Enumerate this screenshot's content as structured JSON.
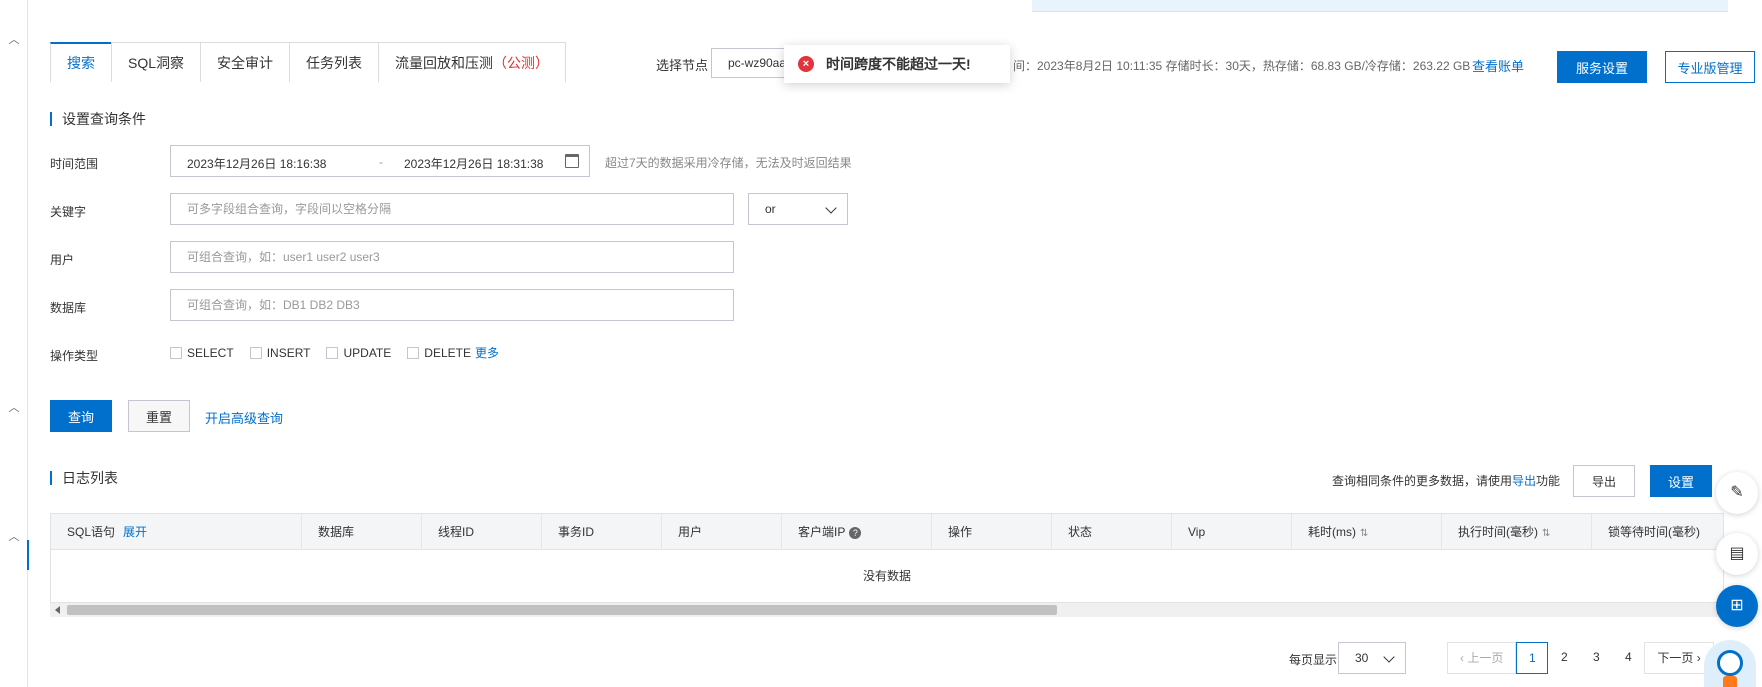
{
  "tabs": [
    {
      "label": "搜索",
      "suffix": ""
    },
    {
      "label": "SQL洞察",
      "suffix": ""
    },
    {
      "label": "安全审计",
      "suffix": ""
    },
    {
      "label": "任务列表",
      "suffix": ""
    },
    {
      "label": "流量回放和压测",
      "suffix": "（公测）"
    }
  ],
  "node": {
    "label": "选择节点",
    "value": "pc-wz90aa",
    "info": "间：2023年8月2日 10:11:35 存储时长：30天，热存储：68.83 GB/冷存储：263.22 GB",
    "bill_link": "查看账单",
    "service_settings": "服务设置",
    "pro_manage": "专业版管理"
  },
  "toast": {
    "message": "时间跨度不能超过一天!",
    "icon": "error-circle-icon"
  },
  "query_section": {
    "title": "设置查询条件",
    "time_label": "时间范围",
    "start_time": "2023年12月26日 18:16:38",
    "separator": "-",
    "end_time": "2023年12月26日 18:31:38",
    "time_hint": "超过7天的数据采用冷存储，无法及时返回结果",
    "keyword_label": "关键字",
    "keyword_value": "",
    "keyword_placeholder": "可多字段组合查询，字段间以空格分隔",
    "logic_value": "or",
    "user_label": "用户",
    "user_value": "",
    "user_placeholder": "可组合查询，如：user1 user2 user3",
    "db_label": "数据库",
    "db_value": "",
    "db_placeholder": "可组合查询，如：DB1 DB2 DB3",
    "op_label": "操作类型",
    "op_types": [
      "SELECT",
      "INSERT",
      "UPDATE",
      "DELETE"
    ],
    "more_link": "更多",
    "query_button": "查询",
    "reset_button": "重置",
    "advanced_link": "开启高级查询"
  },
  "log_section": {
    "title": "日志列表",
    "export_hint_prefix": "查询相同条件的更多数据，请使用",
    "export_hint_link": "导出",
    "export_hint_suffix": "功能",
    "export_button": "导出",
    "settings_button": "设置",
    "columns": {
      "sql": "SQL语句",
      "expand": "展开",
      "database": "数据库",
      "thread_id": "线程ID",
      "tx_id": "事务ID",
      "user": "用户",
      "client_ip": "客户端IP",
      "operation": "操作",
      "status": "状态",
      "vip": "Vip",
      "duration": "耗时(ms)",
      "exec_time": "执行时间(毫秒)",
      "lock_wait": "锁等待时间(毫秒)"
    },
    "empty_text": "没有数据"
  },
  "pagination": {
    "page_size_label": "每页显示",
    "page_size": "30",
    "prev": "上一页",
    "pages": [
      "1",
      "2",
      "3",
      "4"
    ],
    "current_page": "1",
    "next": "下一页"
  },
  "colors": {
    "primary": "#0070cc",
    "error": "#e0353c",
    "accent_red": "#e52f2f"
  }
}
